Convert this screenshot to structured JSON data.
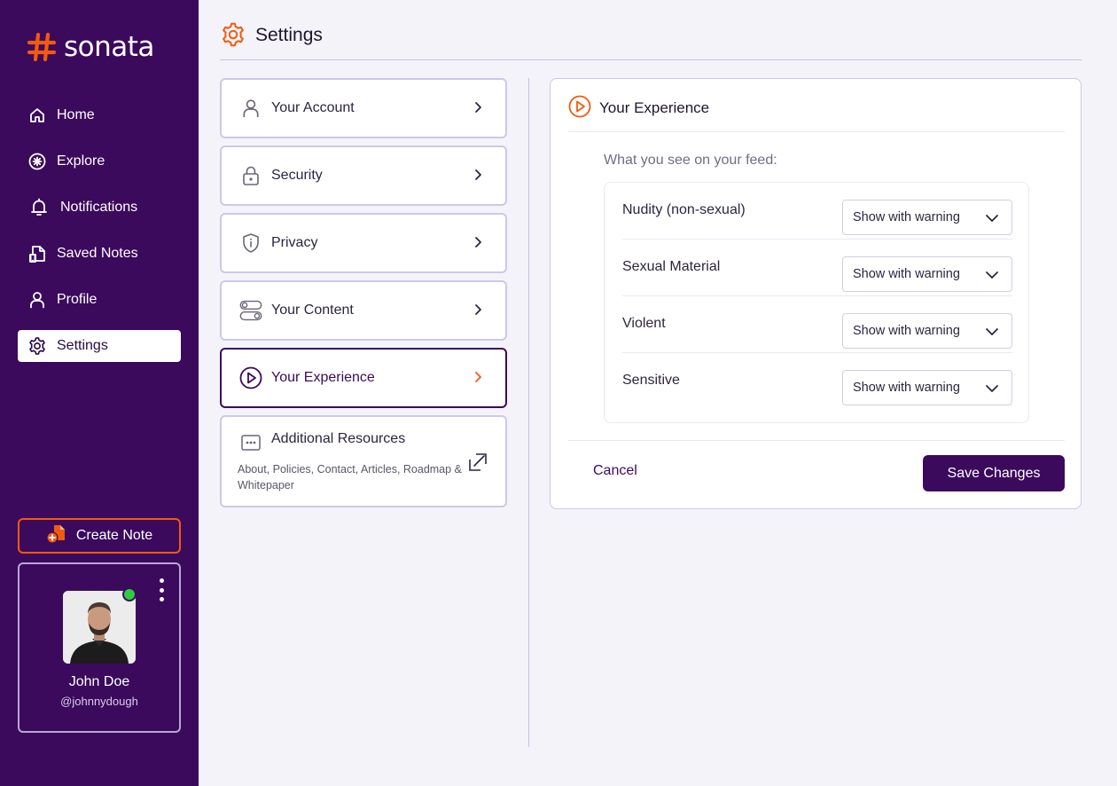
{
  "app": {
    "name": "sonata",
    "colors": {
      "sidebar": "#3b0a5c",
      "accent": "#f25a0f",
      "primary": "#3b0a5c",
      "online": "#2ecc40"
    }
  },
  "sidebar": {
    "nav": [
      {
        "label": "Home",
        "icon": "home-icon"
      },
      {
        "label": "Explore",
        "icon": "explore-icon"
      },
      {
        "label": "Notifications",
        "icon": "bell-icon"
      },
      {
        "label": "Saved Notes",
        "icon": "saved-notes-icon"
      },
      {
        "label": "Profile",
        "icon": "user-icon"
      },
      {
        "label": "Settings",
        "icon": "gear-icon",
        "active": true
      }
    ],
    "create_note": "Create Note",
    "profile": {
      "name": "John Doe",
      "handle": "@johnnydough",
      "online": true
    }
  },
  "header": {
    "title": "Settings"
  },
  "settings_menu": [
    {
      "label": "Your Account",
      "icon": "user-icon"
    },
    {
      "label": "Security",
      "icon": "lock-icon"
    },
    {
      "label": "Privacy",
      "icon": "shield-icon"
    },
    {
      "label": "Your Content",
      "icon": "toggles-icon"
    },
    {
      "label": "Your Experience",
      "icon": "play-circle-icon",
      "active": true
    },
    {
      "label": "Additional Resources",
      "icon": "more-icon",
      "subtitle": "About, Policies, Contact, Articles, Roadmap & Whitepaper"
    }
  ],
  "panel": {
    "title": "Your Experience",
    "feed_label": "What you see on your feed:",
    "filters": [
      {
        "name": "Nudity (non-sexual)",
        "value": "Show with warning"
      },
      {
        "name": "Sexual Material",
        "value": "Show with warning"
      },
      {
        "name": "Violent",
        "value": "Show with warning"
      },
      {
        "name": "Sensitive",
        "value": "Show with warning"
      }
    ],
    "cancel": "Cancel",
    "save": "Save Changes"
  }
}
